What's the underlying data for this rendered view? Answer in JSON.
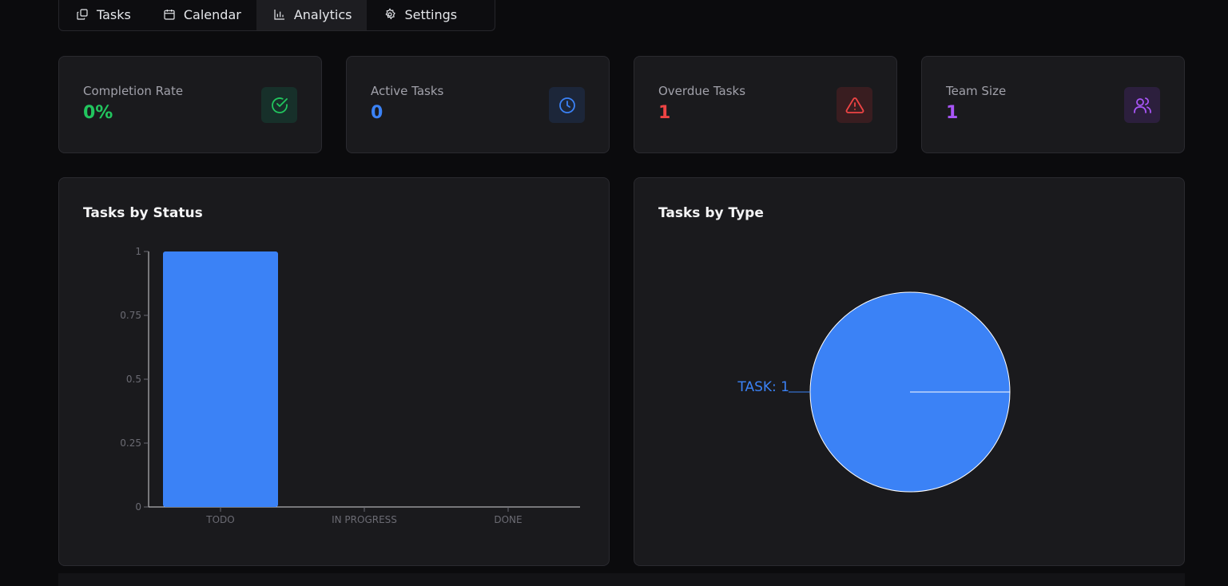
{
  "tabs": [
    {
      "label": "Tasks",
      "icon": "tasks-icon"
    },
    {
      "label": "Calendar",
      "icon": "calendar-icon"
    },
    {
      "label": "Analytics",
      "icon": "analytics-icon",
      "active": true
    },
    {
      "label": "Settings",
      "icon": "settings-icon"
    }
  ],
  "stats": [
    {
      "label": "Completion Rate",
      "value": "0%",
      "color": "#22c55e",
      "icon": "check-circle-icon",
      "icon_bg": "#17302a"
    },
    {
      "label": "Active Tasks",
      "value": "0",
      "color": "#3b82f6",
      "icon": "clock-icon",
      "icon_bg": "#1c2639"
    },
    {
      "label": "Overdue Tasks",
      "value": "1",
      "color": "#ef4444",
      "icon": "alert-triangle-icon",
      "icon_bg": "#391d20"
    },
    {
      "label": "Team Size",
      "value": "1",
      "color": "#a855f7",
      "icon": "users-icon",
      "icon_bg": "#2c1f3d"
    }
  ],
  "panels": {
    "status_title": "Tasks by Status",
    "type_title": "Tasks by Type"
  },
  "chart_data": [
    {
      "type": "bar",
      "title": "Tasks by Status",
      "categories": [
        "TODO",
        "IN PROGRESS",
        "DONE"
      ],
      "values": [
        1,
        0,
        0
      ],
      "ylim": [
        0,
        1
      ],
      "yticks": [
        "0",
        "0.25",
        "0.5",
        "0.75",
        "1"
      ],
      "color": "#3b82f6",
      "grid": false
    },
    {
      "type": "pie",
      "title": "Tasks by Type",
      "slices": [
        {
          "label": "TASK",
          "value": 1
        }
      ],
      "slice_labels": [
        "TASK: 1"
      ],
      "color": "#3b82f6"
    }
  ]
}
